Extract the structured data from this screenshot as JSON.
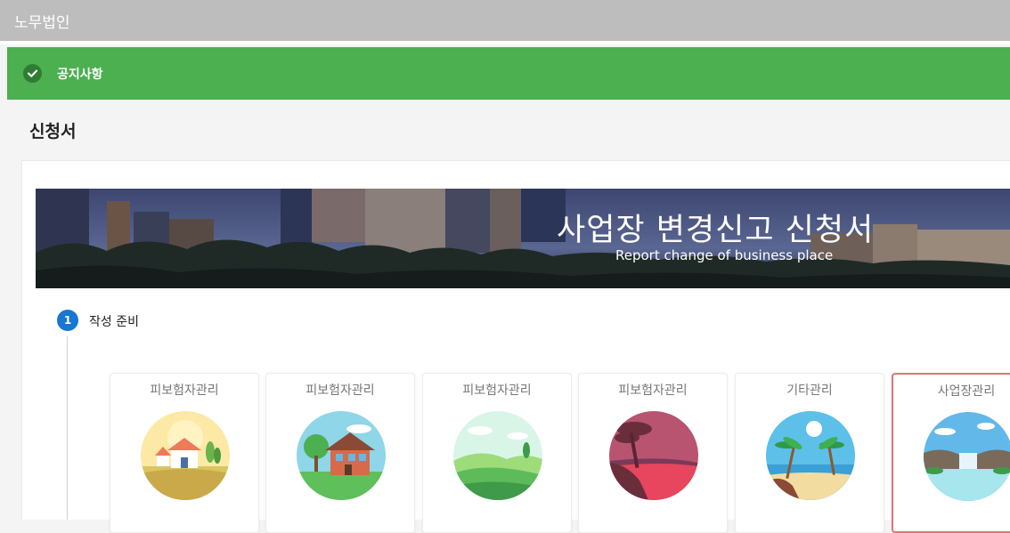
{
  "app": {
    "title": "노무법인"
  },
  "notice": {
    "label": "공지사항",
    "icon": "check-circle-icon"
  },
  "page": {
    "title": "신청서"
  },
  "banner": {
    "title": "사업장 변경신고 신청서",
    "subtitle": "Report change of business place"
  },
  "step": {
    "number": "1",
    "label": "작성 준비"
  },
  "tiles": [
    {
      "label": "피보험자관리",
      "icon": "house-field-illustration",
      "selected": false
    },
    {
      "label": "피보험자관리",
      "icon": "brick-house-illustration",
      "selected": false
    },
    {
      "label": "피보험자관리",
      "icon": "green-hills-illustration",
      "selected": false
    },
    {
      "label": "피보험자관리",
      "icon": "tree-sunset-illustration",
      "selected": false
    },
    {
      "label": "기타관리",
      "icon": "palm-beach-illustration",
      "selected": false
    },
    {
      "label": "사업장관리",
      "icon": "waterfall-lake-illustration",
      "selected": true
    }
  ],
  "colors": {
    "topbar": "#bdbdbd",
    "notice": "#4caf50",
    "step_badge": "#1976d2",
    "selected_border": "#e57373"
  }
}
